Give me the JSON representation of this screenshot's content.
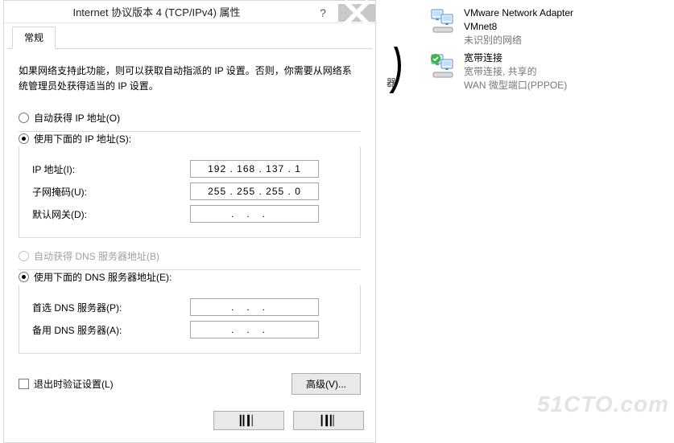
{
  "dialog": {
    "title": "Internet 协议版本 4 (TCP/IPv4) 属性",
    "tab": "常规",
    "description": "如果网络支持此功能，则可以获取自动指派的 IP 设置。否则，你需要从网络系统管理员处获得适当的 IP 设置。",
    "ip_section": {
      "radio_auto": "自动获得 IP 地址(O)",
      "radio_manual": "使用下面的 IP 地址(S):",
      "selected": "manual",
      "ip_label": "IP 地址(I):",
      "ip_value": "192 . 168 . 137 .   1",
      "subnet_label": "子网掩码(U):",
      "subnet_value": "255 . 255 . 255 .   0",
      "gateway_label": "默认网关(D):",
      "gateway_value": ""
    },
    "dns_section": {
      "radio_auto": "自动获得 DNS 服务器地址(B)",
      "radio_manual": "使用下面的 DNS 服务器地址(E):",
      "selected": "manual",
      "pref_label": "首选 DNS 服务器(P):",
      "pref_value": "",
      "alt_label": "备用 DNS 服务器(A):",
      "alt_value": ""
    },
    "validate_checkbox": "退出时验证设置(L)",
    "advanced_button": "高级(V)..."
  },
  "behind_label": "器",
  "network_items": [
    {
      "line1": "VMware Network Adapter",
      "line2": "VMnet8",
      "line3": "未识别的网络",
      "status": "none"
    },
    {
      "line1": "宽带连接",
      "line2": "宽带连接, 共享的",
      "line3": "WAN 微型端口(PPPOE)",
      "status": "connected"
    }
  ],
  "watermark": "51CTO.com"
}
